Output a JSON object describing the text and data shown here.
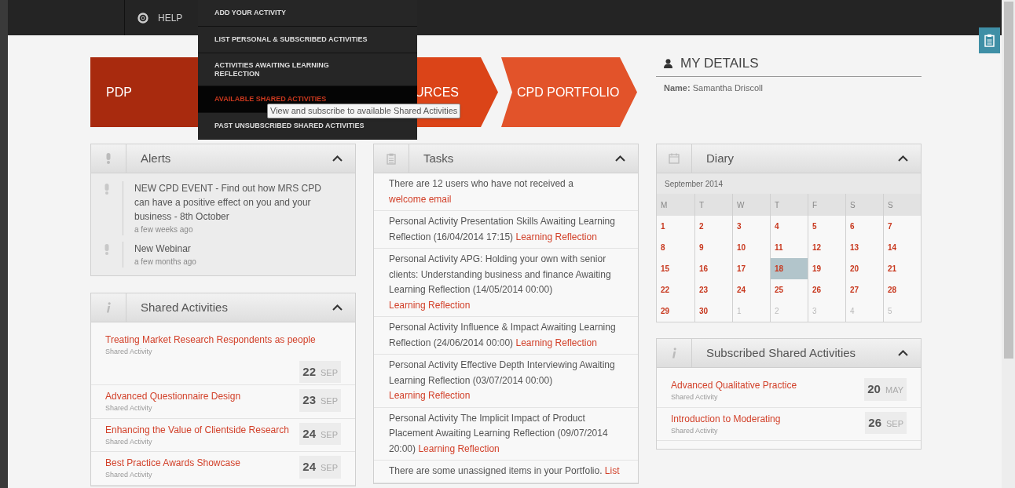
{
  "nav": {
    "help": "HELP"
  },
  "menu": [
    {
      "label": "ADD YOUR ACTIVITY",
      "selected": false
    },
    {
      "label": "LIST PERSONAL & SUBSCRIBED ACTIVITIES",
      "selected": false
    },
    {
      "label": "ACTIVITIES AWAITING LEARNING REFLECTION",
      "selected": false
    },
    {
      "label": "AVAILABLE SHARED ACTIVITIES",
      "selected": true
    },
    {
      "label": "PAST UNSUBSCRIBED SHARED ACTIVITIES",
      "selected": false
    }
  ],
  "tooltip": "View and subscribe to available Shared Activities",
  "banner": [
    {
      "label": "PDP",
      "color": "#a82a0e"
    },
    {
      "label": "URCES",
      "color": "#db4418"
    },
    {
      "label": "CPD PORTFOLIO",
      "color": "#e2532a"
    }
  ],
  "my_details": {
    "title": "MY DETAILS",
    "name_label": "Name:",
    "name": "Samantha Driscoll"
  },
  "alerts": {
    "title": "Alerts",
    "items": [
      {
        "text": "NEW CPD EVENT - Find out how MRS CPD can have a positive effect on you and your business - 8th October",
        "time": "a few weeks ago"
      },
      {
        "text": "New Webinar",
        "time": "a few months ago"
      }
    ]
  },
  "shared_activities": {
    "title": "Shared Activities",
    "items": [
      {
        "title": "Treating Market Research Respondents as people",
        "type": "Shared Activity",
        "day": "22",
        "month": "SEP"
      },
      {
        "title": "Advanced Questionnaire Design",
        "type": "Shared Activity",
        "day": "23",
        "month": "SEP"
      },
      {
        "title": "Enhancing the Value of Clientside Research",
        "type": "Shared Activity",
        "day": "24",
        "month": "SEP"
      },
      {
        "title": "Best Practice Awards Showcase",
        "type": "Shared Activity",
        "day": "24",
        "month": "SEP"
      }
    ]
  },
  "tasks": {
    "title": "Tasks",
    "items": [
      {
        "text": "There are 12 users who have not received a",
        "link": "welcome email"
      },
      {
        "text": "Personal Activity Presentation Skills Awaiting Learning Reflection (16/04/2014 17:15)",
        "link": "Learning Reflection"
      },
      {
        "text": "Personal Activity APG: Holding your own with senior clients: Understanding business and finance Awaiting Learning Reflection (14/05/2014 00:00)",
        "link": "Learning Reflection"
      },
      {
        "text": "Personal Activity Influence & Impact Awaiting Learning Reflection (24/06/2014 00:00)",
        "link": "Learning Reflection"
      },
      {
        "text": "Personal Activity Effective Depth Interviewing Awaiting Learning Reflection (03/07/2014 00:00)",
        "link": "Learning Reflection"
      },
      {
        "text": "Personal Activity The Implicit Impact of Product Placement Awaiting Learning Reflection (09/07/2014 20:00)",
        "link": "Learning Reflection"
      },
      {
        "text": "There are some unassigned items in your Portfolio.",
        "link": "List"
      }
    ]
  },
  "diary": {
    "title": "Diary",
    "month": "September 2014",
    "weekdays": [
      "M",
      "T",
      "W",
      "T",
      "F",
      "S",
      "S"
    ],
    "days": [
      {
        "day": "1",
        "outside": false,
        "selected": false
      },
      {
        "day": "2",
        "outside": false,
        "selected": false
      },
      {
        "day": "3",
        "outside": false,
        "selected": false
      },
      {
        "day": "4",
        "outside": false,
        "selected": false
      },
      {
        "day": "5",
        "outside": false,
        "selected": false
      },
      {
        "day": "6",
        "outside": false,
        "selected": false
      },
      {
        "day": "7",
        "outside": false,
        "selected": false
      },
      {
        "day": "8",
        "outside": false,
        "selected": false
      },
      {
        "day": "9",
        "outside": false,
        "selected": false
      },
      {
        "day": "10",
        "outside": false,
        "selected": false
      },
      {
        "day": "11",
        "outside": false,
        "selected": false
      },
      {
        "day": "12",
        "outside": false,
        "selected": false
      },
      {
        "day": "13",
        "outside": false,
        "selected": false
      },
      {
        "day": "14",
        "outside": false,
        "selected": false
      },
      {
        "day": "15",
        "outside": false,
        "selected": false
      },
      {
        "day": "16",
        "outside": false,
        "selected": false
      },
      {
        "day": "17",
        "outside": false,
        "selected": false
      },
      {
        "day": "18",
        "outside": false,
        "selected": true
      },
      {
        "day": "19",
        "outside": false,
        "selected": false
      },
      {
        "day": "20",
        "outside": false,
        "selected": false
      },
      {
        "day": "21",
        "outside": false,
        "selected": false
      },
      {
        "day": "22",
        "outside": false,
        "selected": false
      },
      {
        "day": "23",
        "outside": false,
        "selected": false
      },
      {
        "day": "24",
        "outside": false,
        "selected": false
      },
      {
        "day": "25",
        "outside": false,
        "selected": false
      },
      {
        "day": "26",
        "outside": false,
        "selected": false
      },
      {
        "day": "27",
        "outside": false,
        "selected": false
      },
      {
        "day": "28",
        "outside": false,
        "selected": false
      },
      {
        "day": "29",
        "outside": false,
        "selected": false
      },
      {
        "day": "30",
        "outside": false,
        "selected": false
      },
      {
        "day": "1",
        "outside": true,
        "selected": false
      },
      {
        "day": "2",
        "outside": true,
        "selected": false
      },
      {
        "day": "3",
        "outside": true,
        "selected": false
      },
      {
        "day": "4",
        "outside": true,
        "selected": false
      },
      {
        "day": "5",
        "outside": true,
        "selected": false
      }
    ]
  },
  "subscribed": {
    "title": "Subscribed Shared Activities",
    "items": [
      {
        "title": "Advanced Qualitative Practice",
        "type": "Shared Activity",
        "day": "20",
        "month": "MAY"
      },
      {
        "title": "Introduction to Moderating",
        "type": "Shared Activity",
        "day": "26",
        "month": "SEP"
      }
    ]
  }
}
